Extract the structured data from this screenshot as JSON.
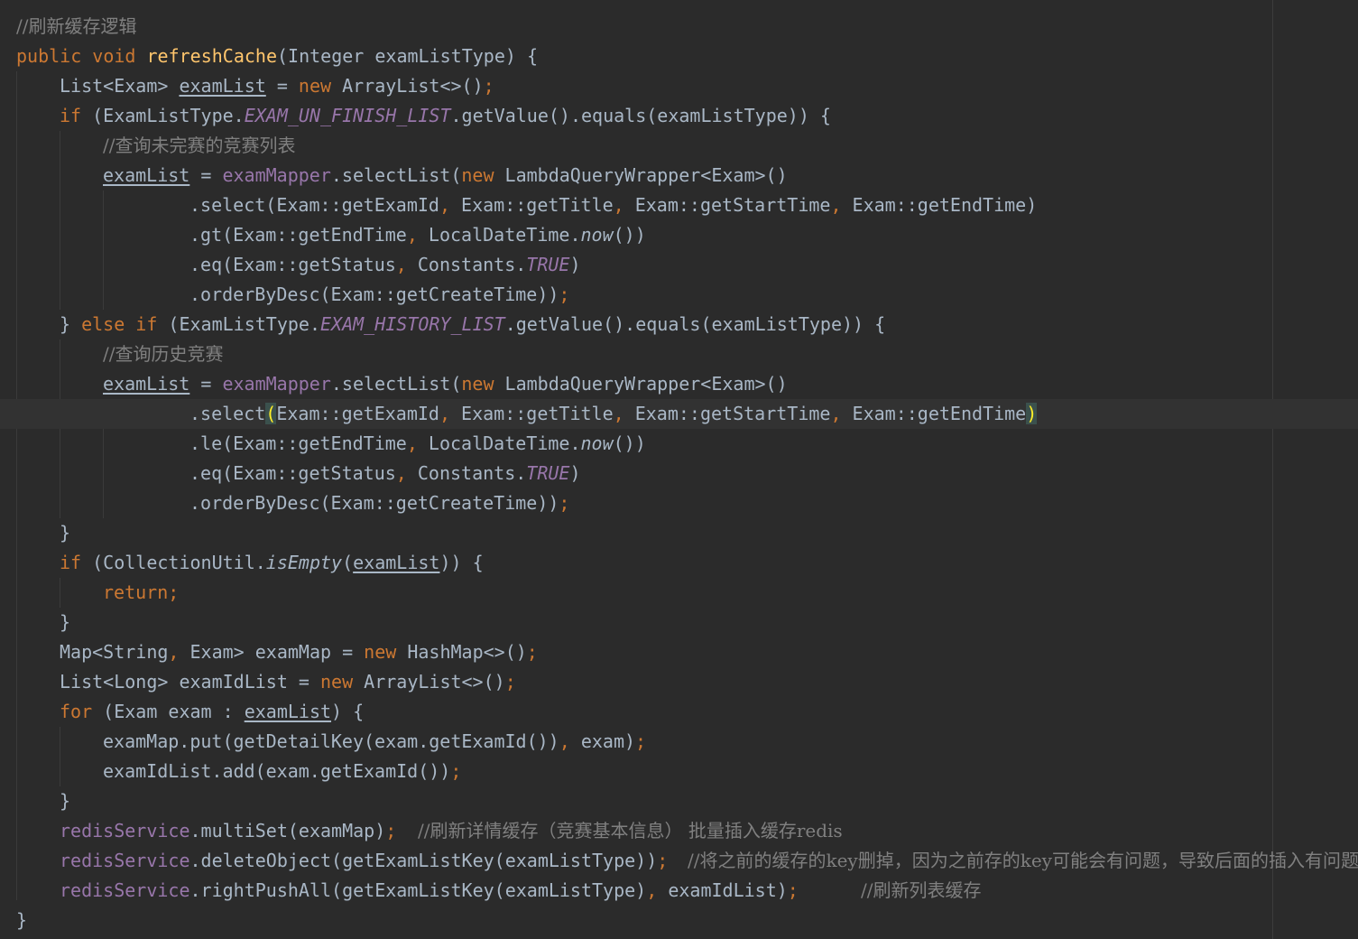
{
  "editor": {
    "language": "java",
    "current_line_index": 13,
    "comments": {
      "c0": "//刷新缓存逻辑",
      "c3": "//查询未完赛的竞赛列表",
      "c10": "//查询历史竞赛",
      "c27": "//刷新详情缓存（竞赛基本信息） 批量插入缓存redis",
      "c28": "//将之前的缓存的key删掉，因为之前存的key可能会有问题，导致后面的插入有问题",
      "c29": "//刷新列表缓存"
    },
    "tokens": {
      "l1_kw_public": "public",
      "l1_kw_void": "void",
      "l1_method": "refreshCache",
      "l1_rest": "(Integer examListType) {",
      "l2_type": "List<Exam> ",
      "l2_var": "examList",
      "l2_eq": " = ",
      "l2_new": "new",
      "l2_rest": " ArrayList<>()",
      "semi": ";",
      "l3_if": "if",
      "l3_a": " (ExamListType.",
      "l3_const": "EXAM_UN_FINISH_LIST",
      "l3_b": ".getValue().equals(examListType)) {",
      "assign_var": "examList",
      "assign_eq": " = ",
      "mapper": "examMapper",
      "select_list": ".selectList(",
      "new_kw": "new",
      "wrapper": " LambdaQueryWrapper<Exam>()",
      "sel_a": ".select",
      "sel_open": "(",
      "sel_1": "Exam::getExamId",
      "comma": ",",
      "sel_2": " Exam::getTitle",
      "sel_3": " Exam::getStartTime",
      "sel_4": " Exam::getEndTime",
      "sel_close": ")",
      "gt": ".gt(Exam::getEndTime",
      "le": ".le(Exam::getEndTime",
      "ldt": " LocalDateTime.",
      "now": "now",
      "ldt_close": "())",
      "eq": ".eq(Exam::getStatus",
      "constants": " Constants.",
      "true_const": "TRUE",
      "close_paren": ")",
      "order": ".orderByDesc(Exam::getCreateTime))",
      "else_close": "} ",
      "else_kw": "else if",
      "l9_a": " (ExamListType.",
      "l9_const": "EXAM_HISTORY_LIST",
      "l9_b": ".getValue().equals(examListType)) {",
      "close_brace": "}",
      "if_kw": "if",
      "l18_a": " (CollectionUtil.",
      "is_empty": "isEmpty",
      "l18_b": "(",
      "l18_var": "examList",
      "l18_c": ")) {",
      "return_kw": "return",
      "l21_a": "Map<String",
      "l21_b": " Exam> examMap = ",
      "l21_new": "new",
      "l21_c": " HashMap<>()",
      "l22_a": "List<Long> examIdList = ",
      "l22_new": "new",
      "l22_c": " ArrayList<>()",
      "for_kw": "for",
      "l23_a": " (Exam exam : ",
      "l23_var": "examList",
      "l23_b": ") {",
      "l24_a": "examMap.put(getDetailKey(exam.getExamId())",
      "l24_b": " exam)",
      "l25_a": "examIdList.add(exam.getExamId())",
      "redis": "redisService",
      "l27_a": ".multiSet(examMap)",
      "l28_a": ".deleteObject(getExamListKey(examListType))",
      "l29_a": ".rightPushAll(getExamListKey(examListType)",
      "l29_b": " examIdList)",
      "final_brace": "}"
    }
  }
}
